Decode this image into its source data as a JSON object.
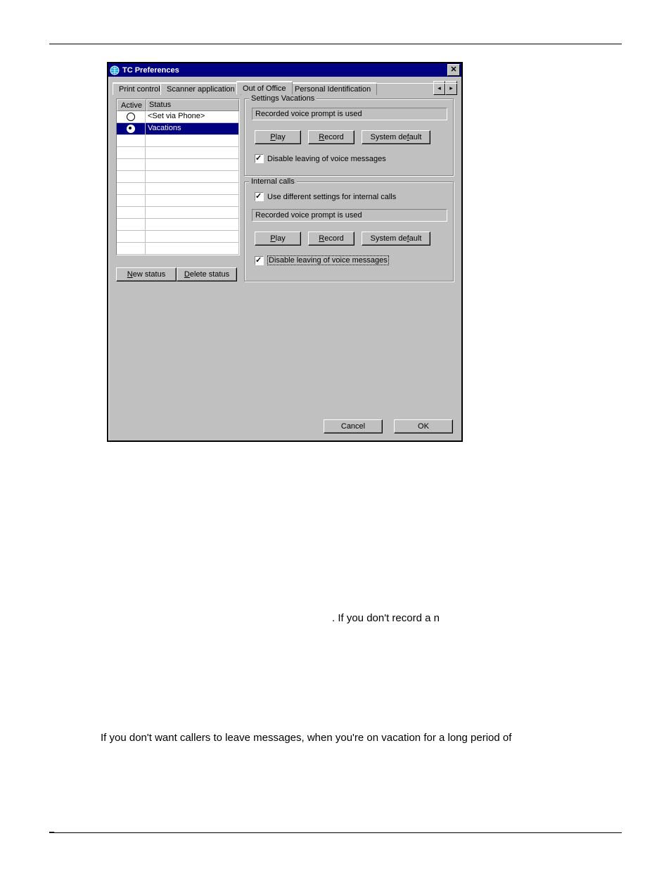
{
  "dialog": {
    "title": "TC Preferences",
    "close_glyph": "✕",
    "tabs": {
      "print": "Print control",
      "scanner": "Scanner application",
      "out": "Out of Office",
      "personal": "Personal Identification"
    },
    "arrows": {
      "left": "◂",
      "right": "▸"
    },
    "table": {
      "col_active": "Active",
      "col_status": "Status",
      "rows": [
        {
          "status": "<Set via Phone>",
          "active": false,
          "selected": false
        },
        {
          "status": "Vacations",
          "active": true,
          "selected": true
        }
      ]
    },
    "buttons_left": {
      "new_status": {
        "u": "N",
        "rest": "ew status"
      },
      "delete_status": {
        "u": "D",
        "rest": "elete status"
      }
    },
    "group1": {
      "legend": "Settings Vacations",
      "prompt_state": "Recorded voice prompt is used",
      "play": {
        "u": "P",
        "rest": "lay"
      },
      "record": {
        "u": "R",
        "rest": "ecord"
      },
      "default": {
        "pre": "System de",
        "u": "f",
        "post": "ault"
      },
      "disable": "Disable leaving of voice messages"
    },
    "group2": {
      "legend": "Internal calls",
      "use_internal": "Use different settings for internal calls",
      "prompt_state": "Recorded voice prompt is used",
      "play": {
        "u": "P",
        "rest": "lay"
      },
      "record": {
        "u": "R",
        "rest": "ecord"
      },
      "default": {
        "pre": "System de",
        "u": "f",
        "post": "ault"
      },
      "disable": "Disable leaving of voice messages"
    },
    "footer": {
      "cancel": "Cancel",
      "ok": "OK"
    }
  },
  "body": {
    "line1": ". If you don't record a n",
    "line2": "If you don't want callers to leave messages, when you're on vacation for a long period of"
  },
  "page_number": "–"
}
